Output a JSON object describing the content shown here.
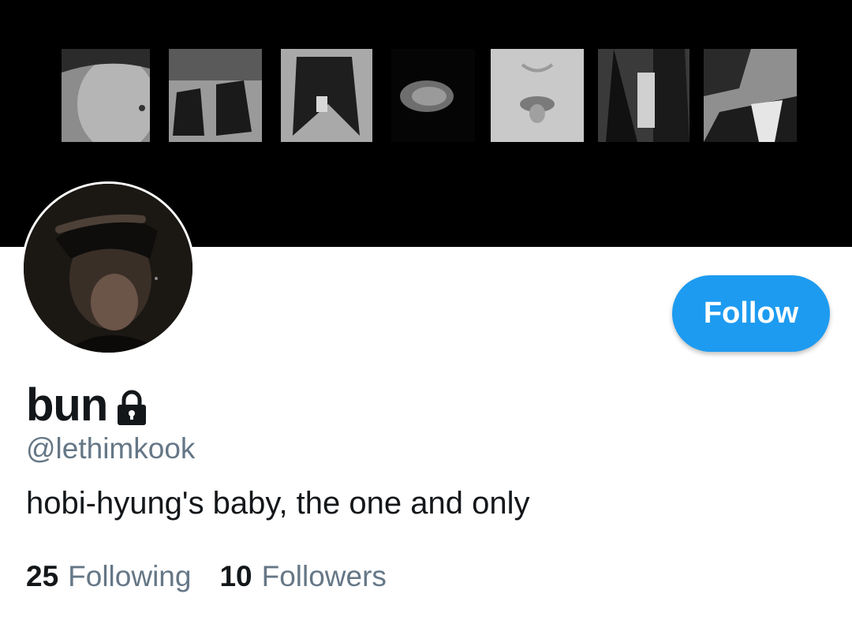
{
  "profile": {
    "display_name": "bun",
    "handle": "@lethimkook",
    "bio": "hobi-hyung's baby, the one and only",
    "protected": true
  },
  "actions": {
    "follow_label": "Follow"
  },
  "stats": {
    "following_count": "25",
    "following_label": "Following",
    "followers_count": "10",
    "followers_label": "Followers"
  },
  "colors": {
    "accent": "#1d9bf0",
    "text_primary": "#14171a",
    "text_secondary": "#657786",
    "banner": "#000000"
  },
  "icons": {
    "protected": "lock-icon"
  }
}
